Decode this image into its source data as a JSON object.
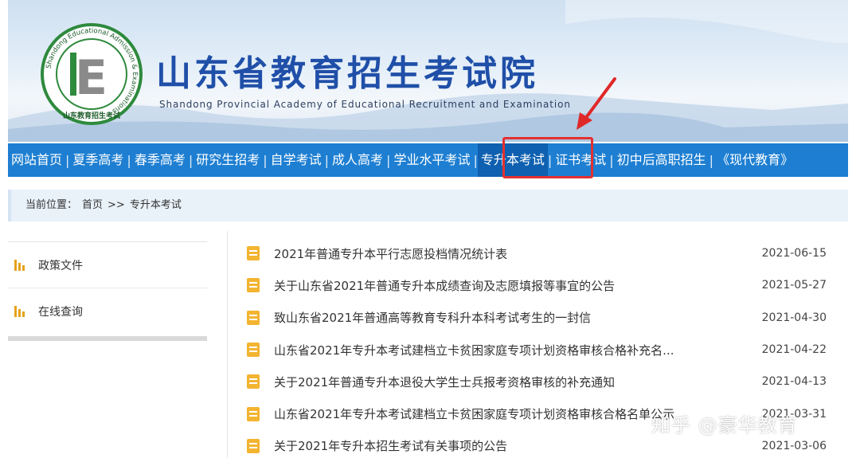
{
  "header": {
    "title": "山东省教育招生考试院",
    "subtitle": "Shandong Provincial Academy of Educational Recruitment and Examination",
    "logo_letter": "E",
    "logo_ring_text": "Shandong Educational Admission & Examinations",
    "logo_bottom_text": "山东教育招生考试"
  },
  "nav": {
    "items": [
      {
        "label": "网站首页"
      },
      {
        "label": "夏季高考"
      },
      {
        "label": "春季高考"
      },
      {
        "label": "研究生招考"
      },
      {
        "label": "自学考试"
      },
      {
        "label": "成人高考"
      },
      {
        "label": "学业水平考试"
      },
      {
        "label": "专升本考试"
      },
      {
        "label": "证书考试"
      },
      {
        "label": "初中后高职招生"
      },
      {
        "label": "《现代教育》"
      }
    ],
    "active_index": 7
  },
  "breadcrumb": {
    "prefix": "当前位置：",
    "home": "首页",
    "sep": ">>",
    "current": "专升本考试"
  },
  "sidebar": {
    "items": [
      {
        "label": "政策文件"
      },
      {
        "label": "在线查询"
      }
    ]
  },
  "news": {
    "items": [
      {
        "title": "2021年普通专升本平行志愿投档情况统计表",
        "date": "2021-06-15"
      },
      {
        "title": "关于山东省2021年普通专升本成绩查询及志愿填报等事宜的公告",
        "date": "2021-05-27"
      },
      {
        "title": "致山东省2021年普通高等教育专科升本科考试考生的一封信",
        "date": "2021-04-30"
      },
      {
        "title": "山东省2021年专升本考试建档立卡贫困家庭专项计划资格审核合格补充名...",
        "date": "2021-04-22"
      },
      {
        "title": "关于2021年普通专升本退役大学生士兵报考资格审核的补充通知",
        "date": "2021-04-13"
      },
      {
        "title": "山东省2021年专升本考试建档立卡贫困家庭专项计划资格审核合格名单公示",
        "date": "2021-03-31"
      },
      {
        "title": "关于2021年专升本招生考试有关事项的公告",
        "date": "2021-03-06"
      }
    ]
  },
  "watermark": "知乎 @豪华教育",
  "colors": {
    "nav_bg": "#1e7fd2",
    "title_blue": "#1f4fa8",
    "highlight_red": "#e23030",
    "icon_orange": "#f3b431"
  }
}
